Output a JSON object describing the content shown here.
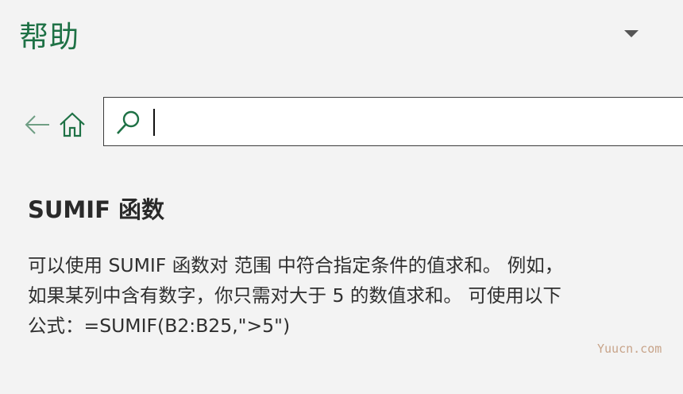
{
  "pane": {
    "title": "帮助",
    "menu_icon": "triangle-down-icon",
    "accent_color": "#1e7145"
  },
  "nav": {
    "back_icon": "arrow-left-icon",
    "home_icon": "home-icon"
  },
  "search": {
    "icon": "search-icon",
    "value": ""
  },
  "article": {
    "title": "SUMIF 函数",
    "body_lines": [
      "可以使用 SUMIF 函数对 范围 中符合指定条件的值求和。 例如，",
      "如果某列中含有数字，你只需对大于 5 的数值求和。 可使用以下",
      "公式：=SUMIF(B2:B25,\">5\")"
    ]
  },
  "watermark": "Yuucn.com"
}
